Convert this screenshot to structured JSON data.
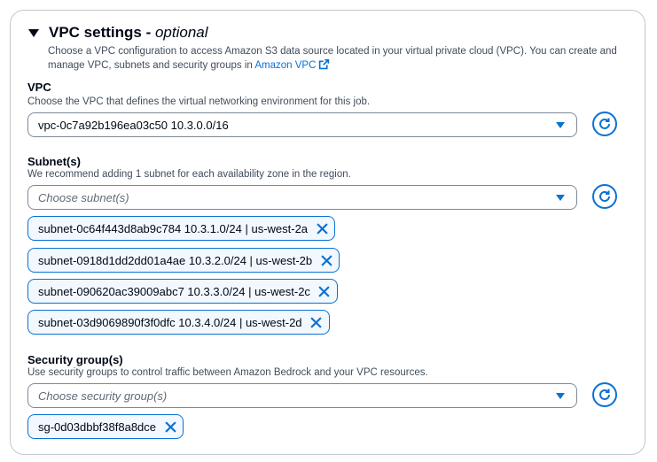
{
  "section": {
    "title": "VPC settings",
    "title_suffix": "optional",
    "separator": " - ",
    "description": "Choose a VPC configuration to access Amazon S3 data source located in your virtual private cloud (VPC). You can create and manage VPC, subnets and security groups in",
    "link_text": "Amazon VPC"
  },
  "vpc": {
    "label": "VPC",
    "description": "Choose the VPC that defines the virtual networking environment for this job.",
    "value": "vpc-0c7a92b196ea03c50 10.3.0.0/16"
  },
  "subnets": {
    "label": "Subnet(s)",
    "description": "We recommend adding 1 subnet for each availability zone in the region.",
    "placeholder": "Choose subnet(s)",
    "tokens": [
      "subnet-0c64f443d8ab9c784 10.3.1.0/24 | us-west-2a",
      "subnet-0918d1dd2dd01a4ae 10.3.2.0/24 | us-west-2b",
      "subnet-090620ac39009abc7 10.3.3.0/24 | us-west-2c",
      "subnet-03d9069890f3f0dfc 10.3.4.0/24 | us-west-2d"
    ]
  },
  "security_groups": {
    "label": "Security group(s)",
    "description": "Use security groups to control traffic between Amazon Bedrock and your VPC resources.",
    "placeholder": "Choose security group(s)",
    "tokens": [
      "sg-0d03dbbf38f8a8dce"
    ]
  },
  "colors": {
    "accent": "#0972d3",
    "text": "#000716",
    "secondary_text": "#414d5c",
    "token_bg": "#f2f8fd"
  },
  "icons": {
    "collapse": "caret-down-icon",
    "external": "external-link-icon",
    "refresh": "refresh-icon",
    "remove": "close-icon"
  }
}
